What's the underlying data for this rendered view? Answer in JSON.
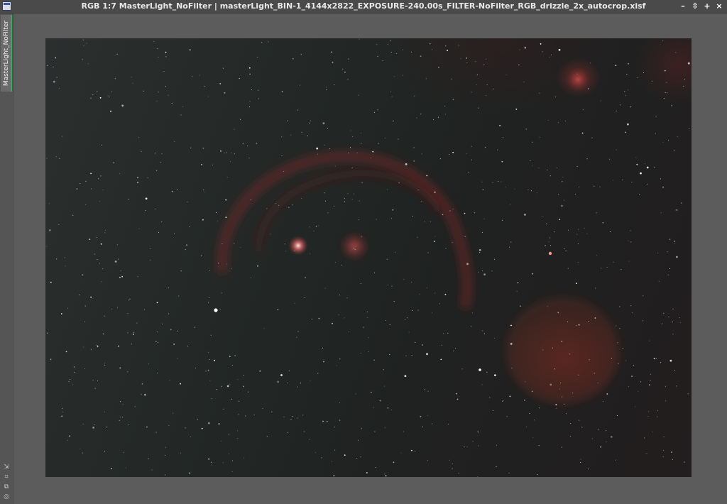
{
  "window": {
    "title": "RGB 1:7 MasterLight_NoFilter | masterLight_BIN-1_4144x2822_EXPOSURE-240.00s_FILTER-NoFilter_RGB_drizzle_2x_autocrop.xisf",
    "controls": {
      "minimize_icon": "–",
      "shade_icon": "⇳",
      "maximize_icon": "+",
      "close_icon": "×"
    }
  },
  "side_panel": {
    "tab_label": "MasterLight_NoFilter",
    "accent_color": "#3aa85a",
    "tools": [
      {
        "name": "zoom-to-fit-icon",
        "glyph": "⇲"
      },
      {
        "name": "fit-view-icon",
        "glyph": "⌗"
      },
      {
        "name": "clone-icon",
        "glyph": "⧉"
      },
      {
        "name": "settings-icon",
        "glyph": "◎"
      }
    ]
  },
  "image": {
    "description_colors": {
      "sky": "#232826",
      "nebula": "#8a2a28",
      "stars": "#ffffff"
    }
  }
}
